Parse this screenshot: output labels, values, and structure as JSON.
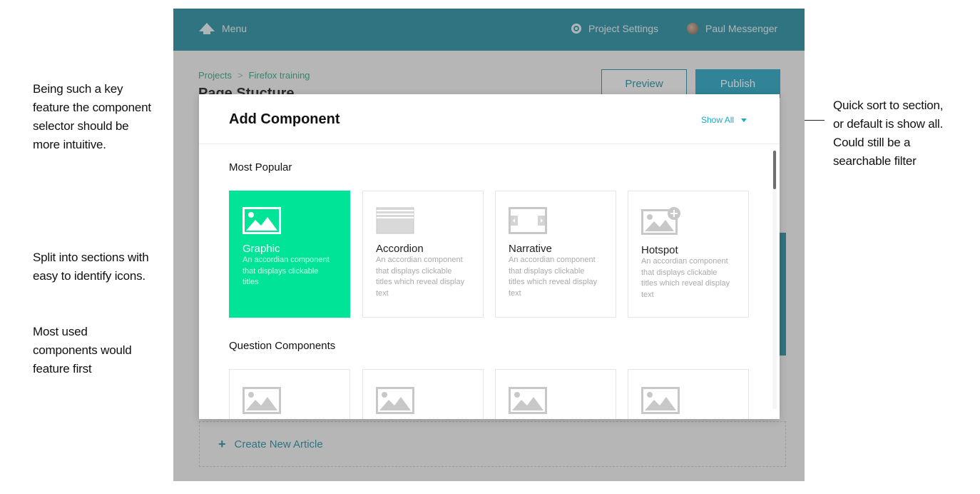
{
  "annotations": {
    "left_1": "Being such a key feature the component selector should be more intuitive.",
    "left_2": "Split into sections with easy to identify icons.",
    "left_3": "Most used components would feature first",
    "right": "Quick sort to section, or default is show all. Could still be a searchable filter"
  },
  "topbar": {
    "menu_label": "Menu",
    "settings_label": "Project Settings",
    "user_name": "Paul Messenger"
  },
  "breadcrumb": {
    "root": "Projects",
    "separator": ">",
    "current": "Firefox training"
  },
  "page": {
    "title": "Page Stucture",
    "preview_label": "Preview",
    "publish_label": "Publish",
    "create_article_label": "Create New Article"
  },
  "modal": {
    "title": "Add Component",
    "filter_label": "Show All",
    "sections": [
      {
        "title": "Most Popular",
        "cards": [
          {
            "name": "Graphic",
            "desc": "An accordian component that displays clickable titles",
            "icon": "graphic-icon",
            "selected": true
          },
          {
            "name": "Accordion",
            "desc": "An accordian component that displays clickable titles which reveal display text",
            "icon": "accordion-icon",
            "selected": false
          },
          {
            "name": "Narrative",
            "desc": "An accordian component that displays clickable titles which reveal display text",
            "icon": "narrative-icon",
            "selected": false
          },
          {
            "name": "Hotspot",
            "desc": "An accordian component that displays clickable titles which reveal display text",
            "icon": "hotspot-icon",
            "selected": false
          }
        ]
      },
      {
        "title": "Question Components",
        "cards": [
          {
            "icon": "image-icon"
          },
          {
            "icon": "image-icon"
          },
          {
            "icon": "image-icon"
          },
          {
            "icon": "image-icon"
          }
        ]
      }
    ]
  },
  "colors": {
    "header": "#2b8fa3",
    "accent": "#1ba9c4",
    "selected_card": "#00e497",
    "breadcrumb": "#3aa58b"
  }
}
